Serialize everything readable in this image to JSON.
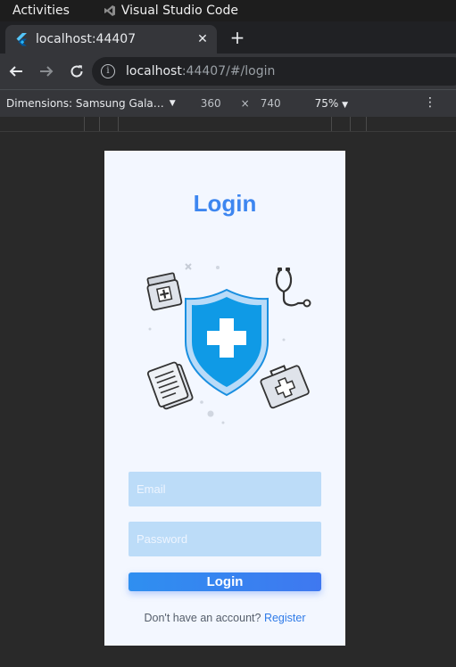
{
  "os_bar": {
    "activities": "Activities",
    "app_name": "Visual Studio Code"
  },
  "browser": {
    "tab_title": "localhost:44407",
    "url_host": "localhost",
    "url_rest": ":44407/#/login"
  },
  "devtools": {
    "device": "Dimensions: Samsung Gala…",
    "width": "360",
    "times": "×",
    "height": "740",
    "zoom": "75%"
  },
  "app": {
    "title": "Login",
    "email_placeholder": "Email",
    "password_placeholder": "Password",
    "login_button": "Login",
    "no_account_text": "Don't have an account?",
    "register_link": "Register"
  },
  "colors": {
    "accent": "#3d86f0",
    "input_bg": "#bcdcf8",
    "page_bg": "#f3f7ff"
  }
}
